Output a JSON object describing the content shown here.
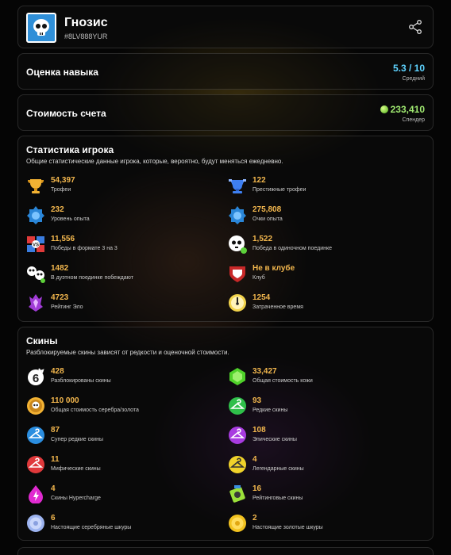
{
  "profile": {
    "name": "Гнозис",
    "tag": "#8LV888YUR"
  },
  "skill": {
    "label": "Оценка навыка",
    "value": "5.3 / 10",
    "sub": "Средний"
  },
  "account_value": {
    "label": "Стоимость счета",
    "value": "233,410",
    "sub": "Спендер"
  },
  "stats": {
    "title": "Статистика игрока",
    "description": "Общие статистические данные игрока, которые, вероятно, будут меняться ежедневно.",
    "items": [
      {
        "value": "54,397",
        "label": "Трофеи",
        "icon": "trophy-icon"
      },
      {
        "value": "122",
        "label": "Престижные трофеи",
        "icon": "prestige-trophy-icon"
      },
      {
        "value": "232",
        "label": "Уровень опыта",
        "icon": "experience-star-icon"
      },
      {
        "value": "275,808",
        "label": "Очки опыта",
        "icon": "experience-points-icon"
      },
      {
        "value": "11,556",
        "label": "Победы в формате 3 на 3",
        "icon": "3v3-icon"
      },
      {
        "value": "1,522",
        "label": "Победа в одиночном поединке",
        "icon": "solo-showdown-icon"
      },
      {
        "value": "1482",
        "label": "В дуэтном поединке побеждают",
        "icon": "duo-showdown-icon"
      },
      {
        "value": "Не в клубе",
        "label": "Клуб",
        "icon": "club-icon"
      },
      {
        "value": "4723",
        "label": "Рейтинг Эло",
        "icon": "elo-rating-icon"
      },
      {
        "value": "1254",
        "label": "Затраченное время",
        "icon": "time-spent-icon"
      }
    ]
  },
  "skins": {
    "title": "Скины",
    "description": "Разблокируемые скины зависят от редкости и оценочной стоимости.",
    "items": [
      {
        "value": "428",
        "label": "Разблокированы скины",
        "icon": "skins-unlocked-icon"
      },
      {
        "value": "33,427",
        "label": "Общая стоимость кожи",
        "icon": "gem-icon"
      },
      {
        "value": "110 000",
        "label": "Общая стоимость серебра/золота",
        "icon": "coin-skull-icon"
      },
      {
        "value": "93",
        "label": "Редкие скины",
        "icon": "rare-hanger-icon"
      },
      {
        "value": "87",
        "label": "Супер редкие скины",
        "icon": "super-rare-hanger-icon"
      },
      {
        "value": "108",
        "label": "Эпические скины",
        "icon": "epic-hanger-icon"
      },
      {
        "value": "11",
        "label": "Мифические скины",
        "icon": "mythic-hanger-icon"
      },
      {
        "value": "4",
        "label": "Легендарные скины",
        "icon": "legendary-hanger-icon"
      },
      {
        "value": "4",
        "label": "Скины Hypercharge",
        "icon": "hypercharge-icon"
      },
      {
        "value": "16",
        "label": "Рейтинговые скины",
        "icon": "ranked-skin-icon"
      },
      {
        "value": "6",
        "label": "Настоящие серебряные шкуры",
        "icon": "silver-coin-icon"
      },
      {
        "value": "2",
        "label": "Настоящие золотые шкуры",
        "icon": "gold-coin-icon"
      }
    ]
  },
  "colors": {
    "accent_value": "#f4b84e",
    "skill_value": "#5ed3ff",
    "money_value": "#9fe870",
    "rare": "#2fbf4a",
    "super_rare": "#2b8ee0",
    "epic": "#a83be0",
    "mythic": "#e0393b",
    "legendary": "#f0d22a"
  }
}
